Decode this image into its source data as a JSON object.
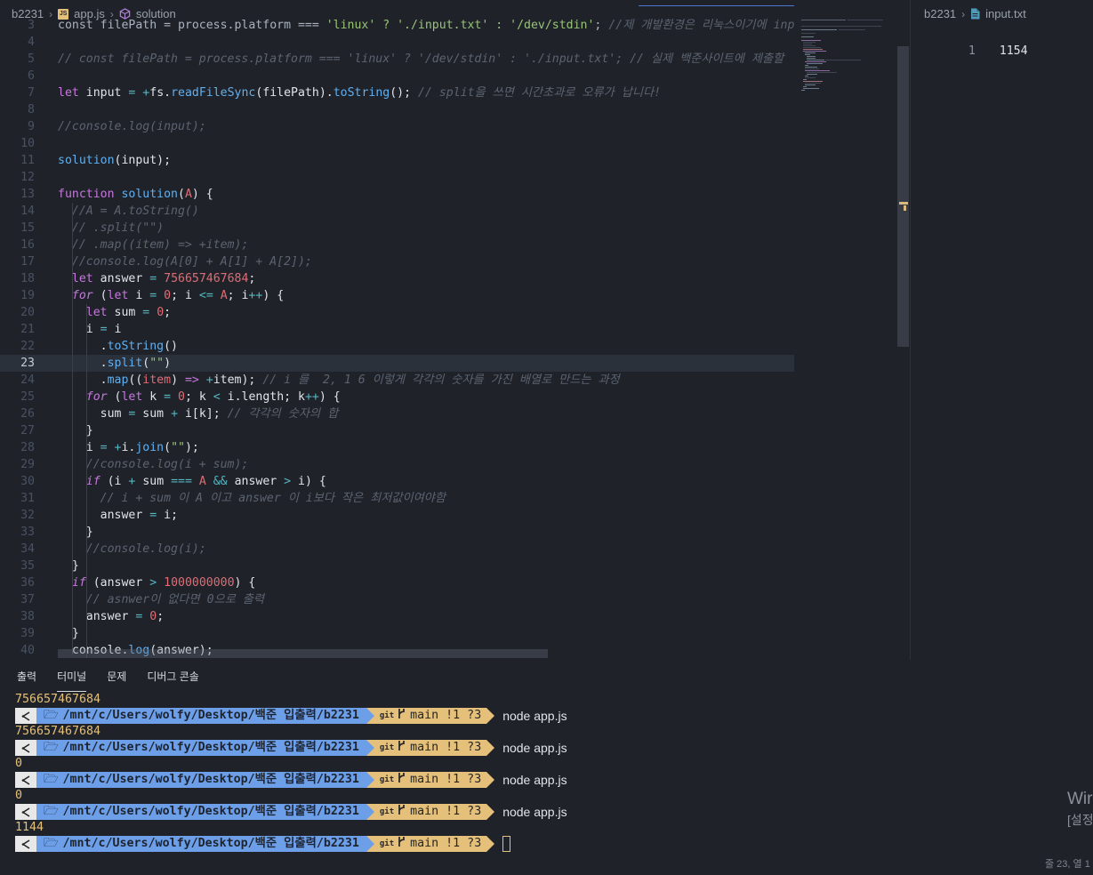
{
  "breadcrumb": {
    "folder": "b2231",
    "file": "app.js",
    "symbol": "solution",
    "file_badge": "JS"
  },
  "editor": {
    "current_line": 23,
    "lines": [
      {
        "n": "3",
        "t": [
          [
            "var",
            "const "
          ],
          [
            "var",
            "filePath = process.platform === "
          ],
          [
            "str",
            "'linux' ? './input.txt' : '/dev/stdin'"
          ],
          [
            "var",
            "; "
          ],
          [
            "cm",
            "//제 개발환경은 리눅스이기에 inp"
          ]
        ]
      },
      {
        "n": "4",
        "t": []
      },
      {
        "n": "5",
        "t": [
          [
            "cm",
            "// const filePath = process.platform === 'linux' ? '/dev/stdin' : './input.txt'; // 실제 백준사이트에 제출할 "
          ]
        ]
      },
      {
        "n": "6",
        "t": []
      },
      {
        "n": "7",
        "t": [
          [
            "kw",
            "let "
          ],
          [
            "wt",
            "input "
          ],
          [
            "op",
            "= "
          ],
          [
            "op",
            "+"
          ],
          [
            "wt",
            "fs."
          ],
          [
            "fn",
            "readFileSync"
          ],
          [
            "wt",
            "(filePath)."
          ],
          [
            "fn",
            "toString"
          ],
          [
            "wt",
            "(); "
          ],
          [
            "cm",
            "// split을 쓰면 시간초과로 오류가 납니다!"
          ]
        ]
      },
      {
        "n": "8",
        "t": []
      },
      {
        "n": "9",
        "t": [
          [
            "cm",
            "//console.log(input);"
          ]
        ]
      },
      {
        "n": "10",
        "t": []
      },
      {
        "n": "11",
        "t": [
          [
            "fn",
            "solution"
          ],
          [
            "wt",
            "(input);"
          ]
        ]
      },
      {
        "n": "12",
        "t": []
      },
      {
        "n": "13",
        "t": [
          [
            "kw",
            "function "
          ],
          [
            "fn",
            "solution"
          ],
          [
            "wt",
            "("
          ],
          [
            "prm",
            "A"
          ],
          [
            "wt",
            ") {"
          ]
        ]
      },
      {
        "n": "14",
        "t": [
          [
            "cm",
            "  //A = A.toString()"
          ]
        ]
      },
      {
        "n": "15",
        "t": [
          [
            "cm",
            "  // .split(\"\")"
          ]
        ]
      },
      {
        "n": "16",
        "t": [
          [
            "cm",
            "  // .map((item) => +item);"
          ]
        ]
      },
      {
        "n": "17",
        "t": [
          [
            "cm",
            "  //console.log(A[0] + A[1] + A[2]);"
          ]
        ]
      },
      {
        "n": "18",
        "t": [
          [
            "wt",
            "  "
          ],
          [
            "kw",
            "let "
          ],
          [
            "wt",
            "answer "
          ],
          [
            "op",
            "= "
          ],
          [
            "num",
            "756657467684"
          ],
          [
            "wt",
            ";"
          ]
        ]
      },
      {
        "n": "19",
        "t": [
          [
            "wt",
            "  "
          ],
          [
            "kwi",
            "for "
          ],
          [
            "wt",
            "("
          ],
          [
            "kw",
            "let "
          ],
          [
            "wt",
            "i "
          ],
          [
            "op",
            "= "
          ],
          [
            "num",
            "0"
          ],
          [
            "wt",
            "; i "
          ],
          [
            "op",
            "<= "
          ],
          [
            "prm",
            "A"
          ],
          [
            "wt",
            "; i"
          ],
          [
            "op",
            "++"
          ],
          [
            "wt",
            ") {"
          ]
        ]
      },
      {
        "n": "20",
        "t": [
          [
            "wt",
            "    "
          ],
          [
            "kw",
            "let "
          ],
          [
            "wt",
            "sum "
          ],
          [
            "op",
            "= "
          ],
          [
            "num",
            "0"
          ],
          [
            "wt",
            ";"
          ]
        ]
      },
      {
        "n": "21",
        "t": [
          [
            "wt",
            "    i "
          ],
          [
            "op",
            "= "
          ],
          [
            "wt",
            "i"
          ]
        ]
      },
      {
        "n": "22",
        "t": [
          [
            "wt",
            "      ."
          ],
          [
            "fn",
            "toString"
          ],
          [
            "wt",
            "()"
          ]
        ]
      },
      {
        "n": "23",
        "t": [
          [
            "wt",
            "      ."
          ],
          [
            "fn",
            "split"
          ],
          [
            "wt",
            "("
          ],
          [
            "str",
            "\"\""
          ],
          [
            "wt",
            ")"
          ]
        ]
      },
      {
        "n": "24",
        "t": [
          [
            "wt",
            "      ."
          ],
          [
            "fn",
            "map"
          ],
          [
            "wt",
            "(("
          ],
          [
            "prm",
            "item"
          ],
          [
            "wt",
            ") "
          ],
          [
            "kw",
            "=> "
          ],
          [
            "op",
            "+"
          ],
          [
            "wt",
            "item); "
          ],
          [
            "cm",
            "// i 를  2, 1 6 이렇게 각각의 숫자를 가진 배열로 만드는 과정"
          ]
        ]
      },
      {
        "n": "25",
        "t": [
          [
            "wt",
            "    "
          ],
          [
            "kwi",
            "for "
          ],
          [
            "wt",
            "("
          ],
          [
            "kw",
            "let "
          ],
          [
            "wt",
            "k "
          ],
          [
            "op",
            "= "
          ],
          [
            "num",
            "0"
          ],
          [
            "wt",
            "; k "
          ],
          [
            "op",
            "< "
          ],
          [
            "wt",
            "i.length; k"
          ],
          [
            "op",
            "++"
          ],
          [
            "wt",
            ") {"
          ]
        ]
      },
      {
        "n": "26",
        "t": [
          [
            "wt",
            "      sum "
          ],
          [
            "op",
            "= "
          ],
          [
            "wt",
            "sum "
          ],
          [
            "op",
            "+ "
          ],
          [
            "wt",
            "i[k]; "
          ],
          [
            "cm",
            "// 각각의 숫자의 합"
          ]
        ]
      },
      {
        "n": "27",
        "t": [
          [
            "wt",
            "    }"
          ]
        ]
      },
      {
        "n": "28",
        "t": [
          [
            "wt",
            "    i "
          ],
          [
            "op",
            "= +"
          ],
          [
            "wt",
            "i."
          ],
          [
            "fn",
            "join"
          ],
          [
            "wt",
            "("
          ],
          [
            "str",
            "\"\""
          ],
          [
            "wt",
            ");"
          ]
        ]
      },
      {
        "n": "29",
        "t": [
          [
            "cm",
            "    //console.log(i + sum);"
          ]
        ]
      },
      {
        "n": "30",
        "t": [
          [
            "wt",
            "    "
          ],
          [
            "kwi",
            "if "
          ],
          [
            "wt",
            "(i "
          ],
          [
            "op",
            "+ "
          ],
          [
            "wt",
            "sum "
          ],
          [
            "op",
            "=== "
          ],
          [
            "prm",
            "A "
          ],
          [
            "op",
            "&& "
          ],
          [
            "wt",
            "answer "
          ],
          [
            "op",
            "> "
          ],
          [
            "wt",
            "i) {"
          ]
        ]
      },
      {
        "n": "31",
        "t": [
          [
            "cm",
            "      // i + sum 이 A 이고 answer 이 i보다 작은 최저값이여야함"
          ]
        ]
      },
      {
        "n": "32",
        "t": [
          [
            "wt",
            "      answer "
          ],
          [
            "op",
            "= "
          ],
          [
            "wt",
            "i;"
          ]
        ]
      },
      {
        "n": "33",
        "t": [
          [
            "wt",
            "    }"
          ]
        ]
      },
      {
        "n": "34",
        "t": [
          [
            "cm",
            "    //console.log(i);"
          ]
        ]
      },
      {
        "n": "35",
        "t": [
          [
            "wt",
            "  }"
          ]
        ]
      },
      {
        "n": "36",
        "t": [
          [
            "wt",
            "  "
          ],
          [
            "kwi",
            "if "
          ],
          [
            "wt",
            "(answer "
          ],
          [
            "op",
            "> "
          ],
          [
            "num",
            "1000000000"
          ],
          [
            "wt",
            ") {"
          ]
        ]
      },
      {
        "n": "37",
        "t": [
          [
            "cm",
            "    // asnwer이 없다면 0으로 출력"
          ]
        ]
      },
      {
        "n": "38",
        "t": [
          [
            "wt",
            "    answer "
          ],
          [
            "op",
            "= "
          ],
          [
            "num",
            "0"
          ],
          [
            "wt",
            ";"
          ]
        ]
      },
      {
        "n": "39",
        "t": [
          [
            "wt",
            "  }"
          ]
        ]
      },
      {
        "n": "40",
        "t": [
          [
            "wt",
            "  console."
          ],
          [
            "fn",
            "log"
          ],
          [
            "wt",
            "(answer);"
          ]
        ]
      }
    ]
  },
  "right_pane": {
    "folder": "b2231",
    "file": "input.txt",
    "line_number": "1",
    "line_text": "1154"
  },
  "panel": {
    "tabs": [
      "출력",
      "터미널",
      "문제",
      "디버그 콘솔"
    ],
    "active_tab": "터미널",
    "prompt": {
      "path_prefix": "/mnt/c/Users/wolfy/Desktop/",
      "path_dir1": "백준 입출력",
      "path_dir2": "/b2231",
      "git_label": "git",
      "branch": "main !1 ?3"
    },
    "entries": [
      {
        "output": "756657467684",
        "command": "node app.js"
      },
      {
        "output": "756657467684",
        "command": "node app.js"
      },
      {
        "output": "0",
        "command": "node app.js"
      },
      {
        "output": "0",
        "command": "node app.js"
      },
      {
        "output": "1144",
        "command": ""
      }
    ]
  },
  "watermark": {
    "line1": "Wir",
    "line2": "[설정"
  },
  "status": {
    "position": "줄 23, 열 1"
  }
}
